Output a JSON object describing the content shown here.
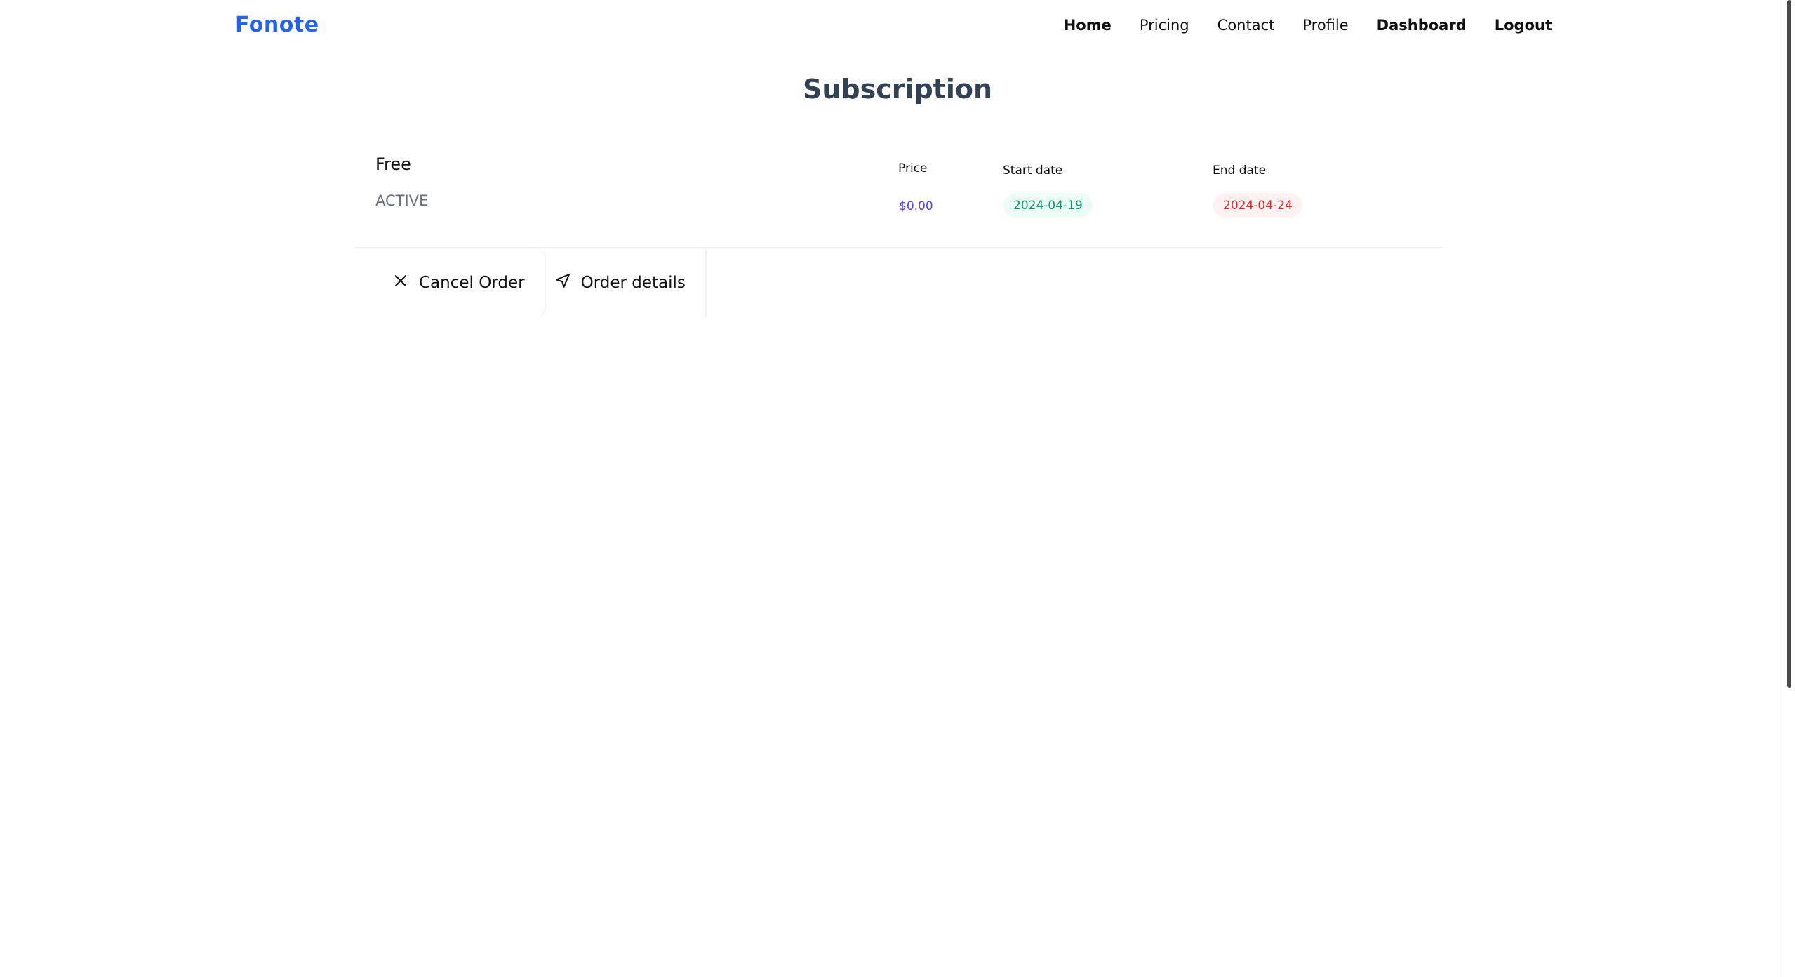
{
  "header": {
    "logo": "Fonote",
    "nav": {
      "home": "Home",
      "pricing": "Pricing",
      "contact": "Contact",
      "profile": "Profile",
      "dashboard": "Dashboard",
      "logout": "Logout"
    }
  },
  "page": {
    "title": "Subscription"
  },
  "subscription": {
    "plan": "Free",
    "status": "ACTIVE",
    "columns": {
      "price": "Price",
      "start_date": "Start date",
      "end_date": "End date"
    },
    "price": "$0.00",
    "start_date": "2024-04-19",
    "end_date": "2024-04-24",
    "actions": {
      "cancel": "Cancel Order",
      "details": "Order details"
    }
  },
  "colors": {
    "brand": "#2563eb",
    "title": "#334155",
    "price": "#4f46e5",
    "start_pill_bg": "#ecfdf5",
    "start_pill_text": "#059669",
    "end_pill_bg": "#fef2f2",
    "end_pill_text": "#dc2626"
  },
  "icons": {
    "cancel": "close-icon",
    "details": "send-icon"
  }
}
